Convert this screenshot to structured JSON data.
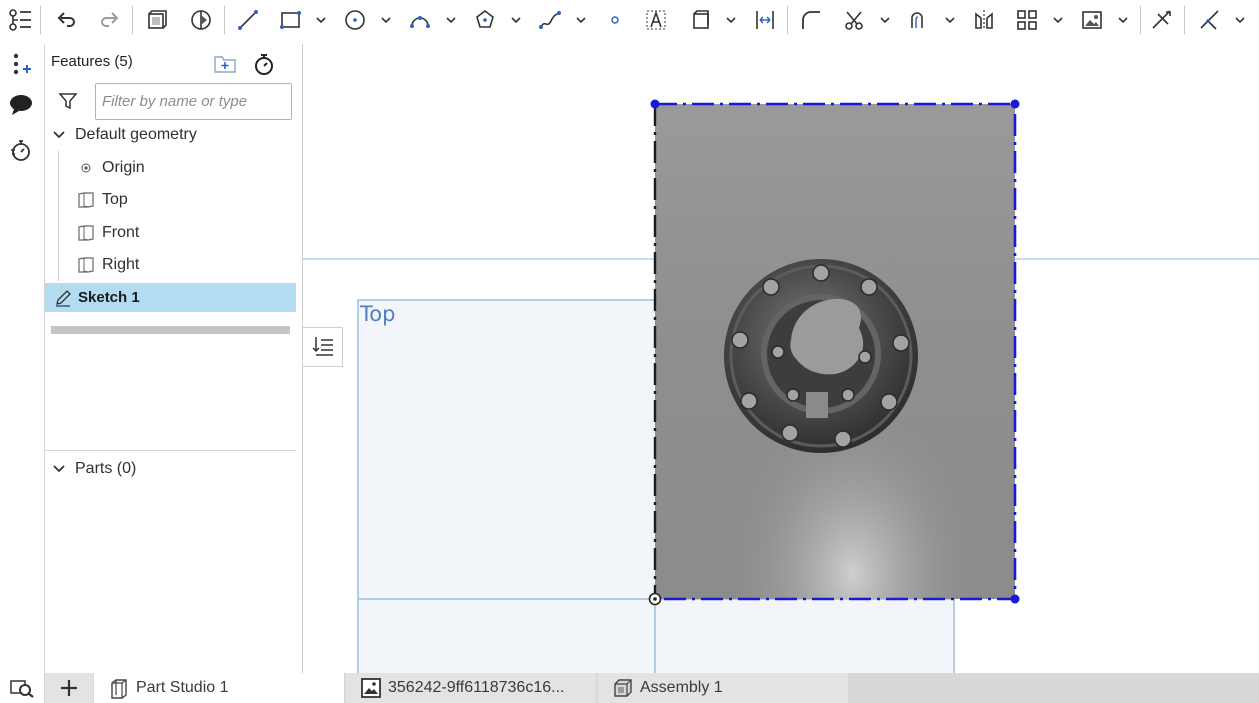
{
  "toolbar": {
    "items": [
      {
        "name": "feature-list-icon"
      },
      {
        "name": "undo-icon"
      },
      {
        "name": "redo-icon"
      },
      {
        "name": "extrude-icon"
      },
      {
        "name": "revolve-icon"
      },
      {
        "name": "line-icon"
      },
      {
        "name": "rectangle-icon"
      },
      {
        "name": "circle-icon"
      },
      {
        "name": "arc-icon"
      },
      {
        "name": "polygon-icon"
      },
      {
        "name": "spline-icon"
      },
      {
        "name": "point-icon"
      },
      {
        "name": "text-icon"
      },
      {
        "name": "construction-icon"
      },
      {
        "name": "dimension-icon"
      },
      {
        "name": "fillet-icon"
      },
      {
        "name": "trim-icon"
      },
      {
        "name": "offset-icon"
      },
      {
        "name": "mirror-icon"
      },
      {
        "name": "pattern-icon"
      },
      {
        "name": "insert-image-icon"
      },
      {
        "name": "normal-to-icon"
      },
      {
        "name": "snap-icon"
      }
    ]
  },
  "rail": {
    "items": [
      {
        "name": "add-variable-icon"
      },
      {
        "name": "comments-icon"
      },
      {
        "name": "history-icon"
      }
    ]
  },
  "features": {
    "title": "Features (5)",
    "filter_placeholder": "Filter by name or type",
    "group_default": "Default geometry",
    "items": [
      {
        "label": "Origin",
        "icon": "origin-icon"
      },
      {
        "label": "Top",
        "icon": "plane-icon"
      },
      {
        "label": "Front",
        "icon": "plane-icon"
      },
      {
        "label": "Right",
        "icon": "plane-icon"
      }
    ],
    "selected": {
      "label": "Sketch 1",
      "icon": "sketch-pencil-icon"
    },
    "parts": "Parts (0)"
  },
  "viewport": {
    "plane_label": "Top",
    "colors": {
      "plane_fill": "#f2f6fa",
      "plane_edge": "#9fbedb",
      "sketch_edge": "#1a1ad6",
      "image_bg": "#8f8f8f"
    }
  },
  "tabs": [
    {
      "label": "Part Studio 1",
      "icon": "part-studio-icon",
      "active": true
    },
    {
      "label": "356242-9ff6118736c16...",
      "icon": "image-icon",
      "active": false
    },
    {
      "label": "Assembly 1",
      "icon": "assembly-icon",
      "active": false
    }
  ]
}
